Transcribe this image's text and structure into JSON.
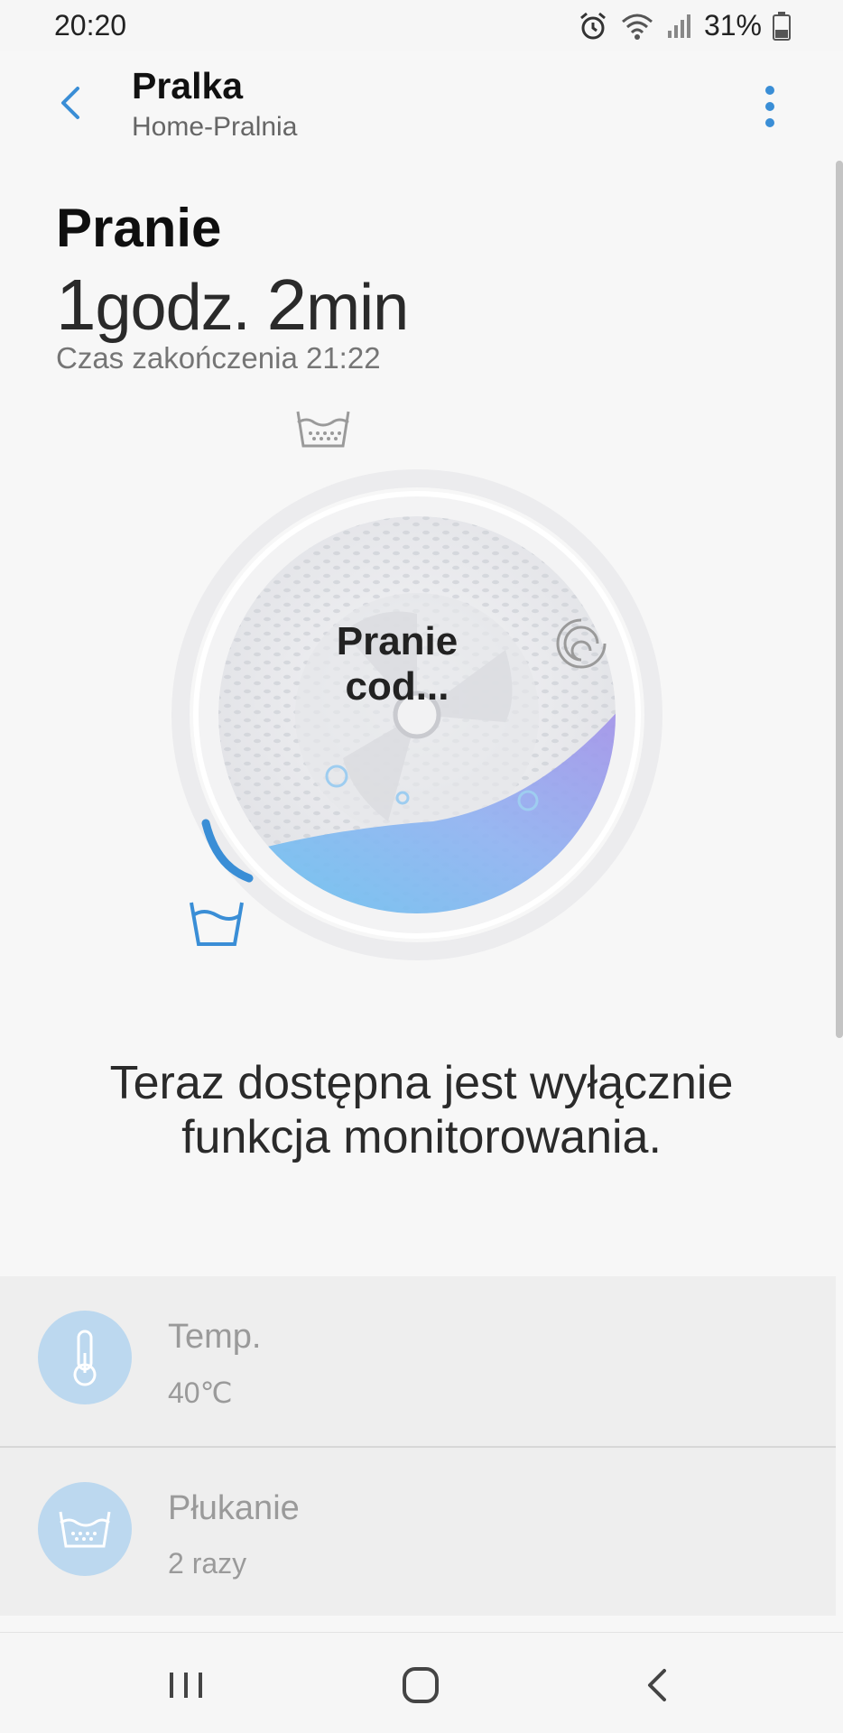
{
  "status_bar": {
    "time": "20:20",
    "battery_percent": "31%",
    "icons": [
      "alarm-icon",
      "wifi-icon",
      "signal-icon",
      "battery-icon"
    ]
  },
  "app_bar": {
    "title": "Pralka",
    "subtitle": "Home-Pralnia",
    "back_icon": "chevron-left-icon",
    "menu_icon": "more-vertical-icon",
    "accent_color": "#3a8ed6"
  },
  "cycle": {
    "phase": "Pranie",
    "remaining_hours": "1",
    "hours_unit": "godz.",
    "remaining_minutes": "2",
    "minutes_unit": "min",
    "end_time_text": "Czas zakończenia 21:22"
  },
  "dial": {
    "label": "Pranie cod...",
    "stage_icons": [
      "wash-tub-icon",
      "rinse-tub-icon",
      "spin-icon"
    ],
    "active_stage": "wash-tub-icon",
    "progress_fraction": 0.06
  },
  "notice": {
    "line1": "Teraz dostępna jest wyłącznie",
    "line2": "funkcja monitorowania."
  },
  "settings": [
    {
      "name": "Temp.",
      "value": "40℃",
      "icon": "thermometer-icon"
    },
    {
      "name": "Płukanie",
      "value": "2 razy",
      "icon": "rinse-tub-icon"
    }
  ],
  "nav_bar": {
    "icons": [
      "recent-apps-icon",
      "home-icon",
      "back-icon"
    ]
  }
}
